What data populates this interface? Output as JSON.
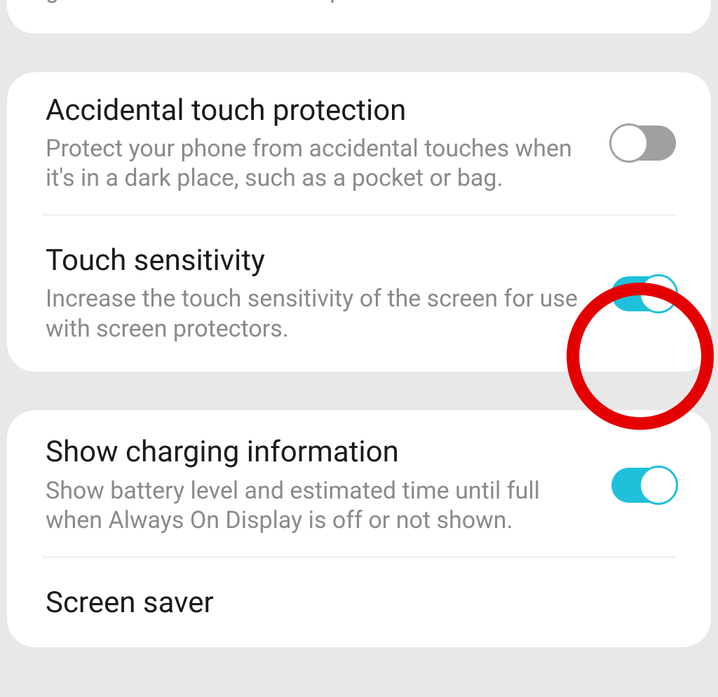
{
  "card_top": {
    "partial_desc": "gestures for more screen space."
  },
  "card_middle": {
    "accidental_touch": {
      "title": "Accidental touch protection",
      "desc": "Protect your phone from accidental touches when it's in a dark place, such as a pocket or bag.",
      "enabled": false
    },
    "touch_sensitivity": {
      "title": "Touch sensitivity",
      "desc": "Increase the touch sensitivity of the screen for use with screen protectors.",
      "enabled": true
    }
  },
  "card_bottom": {
    "charging_info": {
      "title": "Show charging information",
      "desc": "Show battery level and estimated time until full when Always On Display is off or not shown.",
      "enabled": true
    },
    "screen_saver": {
      "title": "Screen saver"
    }
  },
  "colors": {
    "accent": "#1ec1d9",
    "highlight": "#e40000"
  }
}
